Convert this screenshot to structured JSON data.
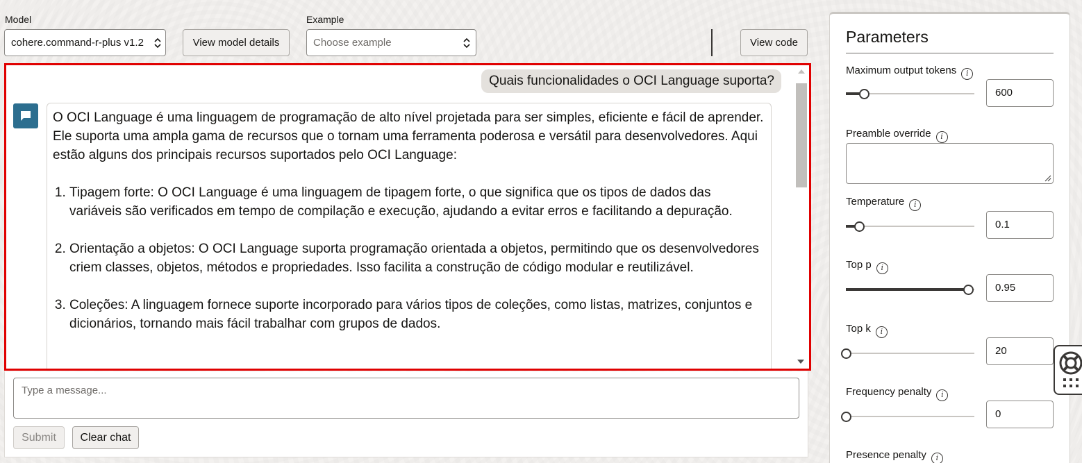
{
  "toolbar": {
    "model_label": "Model",
    "model_value": "cohere.command-r-plus v1.2",
    "view_model_details": "View model details",
    "example_label": "Example",
    "example_placeholder": "Choose example",
    "view_code": "View code"
  },
  "chat": {
    "user_message": "Quais funcionalidades o OCI Language suporta?",
    "bot_intro": "O OCI Language é uma linguagem de programação de alto nível projetada para ser simples, eficiente e fácil de aprender. Ele suporta uma ampla gama de recursos que o tornam uma ferramenta poderosa e versátil para desenvolvedores. Aqui estão alguns dos principais recursos suportados pelo OCI Language:",
    "bot_items": [
      "Tipagem forte: O OCI Language é uma linguagem de tipagem forte, o que significa que os tipos de dados das variáveis são verificados em tempo de compilação e execução, ajudando a evitar erros e facilitando a depuração.",
      "Orientação a objetos: O OCI Language suporta programação orientada a objetos, permitindo que os desenvolvedores criem classes, objetos, métodos e propriedades. Isso facilita a construção de código modular e reutilizável.",
      "Coleções: A linguagem fornece suporte incorporado para vários tipos de coleções, como listas, matrizes, conjuntos e dicionários, tornando mais fácil trabalhar com grupos de dados."
    ]
  },
  "composer": {
    "placeholder": "Type a message...",
    "submit": "Submit",
    "clear_chat": "Clear chat"
  },
  "parameters": {
    "title": "Parameters",
    "max_tokens": {
      "label": "Maximum output tokens",
      "value": "600",
      "fraction": 0.14
    },
    "preamble": {
      "label": "Preamble override",
      "value": ""
    },
    "temperature": {
      "label": "Temperature",
      "value": "0.1",
      "fraction": 0.1
    },
    "top_p": {
      "label": "Top p",
      "value": "0.95",
      "fraction": 0.95
    },
    "top_k": {
      "label": "Top k",
      "value": "20",
      "fraction": 0.0
    },
    "frequency_penalty": {
      "label": "Frequency penalty",
      "value": "0",
      "fraction": 0.0
    },
    "presence_penalty": {
      "label": "Presence penalty"
    }
  },
  "colors": {
    "highlight_border": "#e00000",
    "avatar": "#2c6e8f",
    "user_bubble": "#e4e1dd"
  }
}
